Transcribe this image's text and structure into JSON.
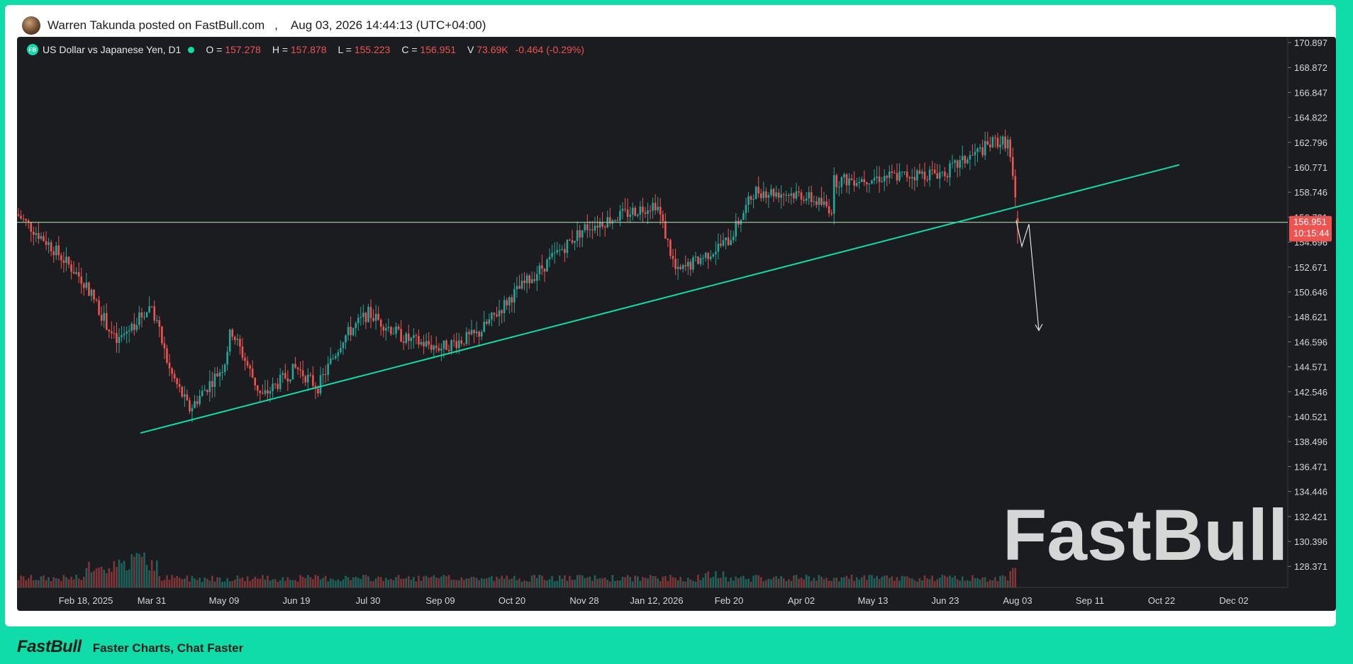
{
  "post": {
    "author_line": "Warren Takunda posted on FastBull.com",
    "separator": ",",
    "timestamp": "Aug 03, 2026 14:44:13 (UTC+04:00)"
  },
  "instrument": {
    "badge": "FB",
    "name": "US Dollar vs Japanese Yen, D1",
    "o_label": "O =",
    "o": "157.278",
    "h_label": "H =",
    "h": "157.878",
    "l_label": "L =",
    "l": "155.223",
    "c_label": "C =",
    "c": "156.951",
    "v_label": "V",
    "v": "73.69K",
    "change": "-0.464 (-0.29%)"
  },
  "price_tag": {
    "price": "156.951",
    "countdown": "10:15:44"
  },
  "watermark": "FastBull",
  "footer": {
    "logo": "FastBull",
    "tagline": "Faster Charts, Chat Faster"
  },
  "colors": {
    "up": "#26a69a",
    "down": "#ef5350",
    "background": "#1b1c20",
    "accent": "#10dcaa",
    "level_line": "#a5d6a7"
  },
  "chart_data": {
    "type": "candlestick",
    "y_ticks": [
      "170.897",
      "168.872",
      "166.847",
      "164.822",
      "162.796",
      "160.771",
      "158.746",
      "156.721",
      "154.696",
      "152.671",
      "150.646",
      "148.621",
      "146.596",
      "144.571",
      "142.546",
      "140.521",
      "138.496",
      "136.471",
      "134.446",
      "132.421",
      "130.396",
      "128.371"
    ],
    "ylim": [
      127.0,
      171.5
    ],
    "x_ticks": [
      "Feb 18, 2025",
      "Mar 31",
      "May 09",
      "Jun 19",
      "Jul 30",
      "Sep 09",
      "Oct 20",
      "Nov 28",
      "Jan 12, 2026",
      "Feb 20",
      "Apr 02",
      "May 13",
      "Jun 23",
      "Aug 03",
      "Sep 11",
      "Oct 22",
      "Dec 02"
    ],
    "key_closes": [
      [
        "Jan 2025",
        157.6
      ],
      [
        "Feb 05",
        155.2
      ],
      [
        "Feb 18, 2025",
        152.0
      ],
      [
        "Mar 10",
        147.2
      ],
      [
        "Mar 31",
        150.3
      ],
      [
        "Apr 10",
        145.0
      ],
      [
        "Apr 21",
        141.8
      ],
      [
        "May 09",
        145.4
      ],
      [
        "May 13",
        148.3
      ],
      [
        "Jun 02",
        142.8
      ],
      [
        "Jun 19",
        145.2
      ],
      [
        "Jul 01",
        143.6
      ],
      [
        "Jul 15",
        147.6
      ],
      [
        "Jul 30",
        149.6
      ],
      [
        "Aug 20",
        147.5
      ],
      [
        "Sep 09",
        146.8
      ],
      [
        "Oct 01",
        147.9
      ],
      [
        "Oct 20",
        151.0
      ],
      [
        "Nov 28",
        156.5
      ],
      [
        "Jan 12, 2026",
        158.5
      ],
      [
        "Jan 20",
        152.8
      ],
      [
        "Feb 20",
        155.5
      ],
      [
        "Mar 05",
        159.5
      ],
      [
        "Apr 02",
        159.2
      ],
      [
        "Apr 20",
        158.0
      ],
      [
        "May 13",
        156.5
      ],
      [
        "Jun 23",
        161.0
      ],
      [
        "Jul 20",
        163.5
      ],
      [
        "Jul 26",
        163.4
      ],
      [
        "Aug 03",
        156.951
      ]
    ],
    "last": {
      "open": 157.278,
      "high": 157.878,
      "low": 155.223,
      "close": 156.951,
      "volume": "73.69K"
    },
    "trendline": {
      "from": [
        "Mar 31",
        139.9
      ],
      "to": [
        "Oct 22",
        161.6
      ]
    },
    "horizontal_level": 156.951,
    "forecast_path": [
      [
        "Aug 03",
        157.1
      ],
      [
        "Aug 03",
        155.0
      ],
      [
        "Aug 03",
        156.8
      ],
      [
        "Aug 10",
        148.2
      ]
    ]
  }
}
